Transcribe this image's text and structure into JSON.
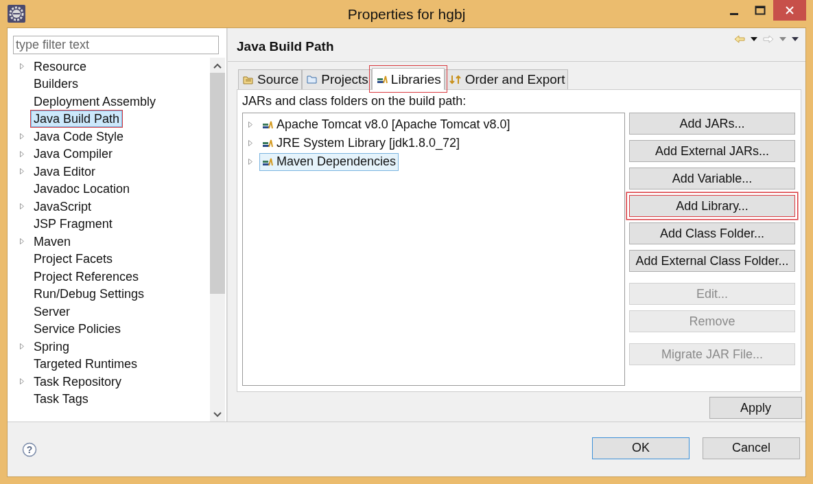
{
  "window": {
    "title": "Properties for hgbj"
  },
  "filter": {
    "placeholder": "type filter text"
  },
  "tree": [
    {
      "label": "Resource",
      "expandable": true,
      "selected": false,
      "annotated": false
    },
    {
      "label": "Builders",
      "expandable": false,
      "selected": false,
      "annotated": false
    },
    {
      "label": "Deployment Assembly",
      "expandable": false,
      "selected": false,
      "annotated": false
    },
    {
      "label": "Java Build Path",
      "expandable": false,
      "selected": true,
      "annotated": true
    },
    {
      "label": "Java Code Style",
      "expandable": true,
      "selected": false,
      "annotated": false
    },
    {
      "label": "Java Compiler",
      "expandable": true,
      "selected": false,
      "annotated": false
    },
    {
      "label": "Java Editor",
      "expandable": true,
      "selected": false,
      "annotated": false
    },
    {
      "label": "Javadoc Location",
      "expandable": false,
      "selected": false,
      "annotated": false
    },
    {
      "label": "JavaScript",
      "expandable": true,
      "selected": false,
      "annotated": false
    },
    {
      "label": "JSP Fragment",
      "expandable": false,
      "selected": false,
      "annotated": false
    },
    {
      "label": "Maven",
      "expandable": true,
      "selected": false,
      "annotated": false
    },
    {
      "label": "Project Facets",
      "expandable": false,
      "selected": false,
      "annotated": false
    },
    {
      "label": "Project References",
      "expandable": false,
      "selected": false,
      "annotated": false
    },
    {
      "label": "Run/Debug Settings",
      "expandable": false,
      "selected": false,
      "annotated": false
    },
    {
      "label": "Server",
      "expandable": false,
      "selected": false,
      "annotated": false
    },
    {
      "label": "Service Policies",
      "expandable": false,
      "selected": false,
      "annotated": false
    },
    {
      "label": "Spring",
      "expandable": true,
      "selected": false,
      "annotated": false
    },
    {
      "label": "Targeted Runtimes",
      "expandable": false,
      "selected": false,
      "annotated": false
    },
    {
      "label": "Task Repository",
      "expandable": true,
      "selected": false,
      "annotated": false
    },
    {
      "label": "Task Tags",
      "expandable": false,
      "selected": false,
      "annotated": false
    }
  ],
  "page": {
    "title": "Java Build Path"
  },
  "tabs": [
    {
      "label": "Source",
      "kind": "source",
      "selected": false,
      "annotated": false
    },
    {
      "label": "Projects",
      "kind": "projects",
      "selected": false,
      "annotated": false
    },
    {
      "label": "Libraries",
      "kind": "libraries",
      "selected": true,
      "annotated": true
    },
    {
      "label": "Order and Export",
      "kind": "order",
      "selected": false,
      "annotated": false
    }
  ],
  "libraries": {
    "caption": "JARs and class folders on the build path:",
    "entries": [
      {
        "label": "Apache Tomcat v8.0 [Apache Tomcat v8.0]",
        "selected": false
      },
      {
        "label": "JRE System Library [jdk1.8.0_72]",
        "selected": false
      },
      {
        "label": "Maven Dependencies",
        "selected": true
      }
    ]
  },
  "button_groups": [
    [
      {
        "label": "Add JARs...",
        "disabled": false,
        "annotated": false
      },
      {
        "label": "Add External JARs...",
        "disabled": false,
        "annotated": false
      },
      {
        "label": "Add Variable...",
        "disabled": false,
        "annotated": false
      },
      {
        "label": "Add Library...",
        "disabled": false,
        "annotated": true
      },
      {
        "label": "Add Class Folder...",
        "disabled": false,
        "annotated": false
      },
      {
        "label": "Add External Class Folder...",
        "disabled": false,
        "annotated": false
      }
    ],
    [
      {
        "label": "Edit...",
        "disabled": true,
        "annotated": false
      },
      {
        "label": "Remove",
        "disabled": true,
        "annotated": false
      }
    ],
    [
      {
        "label": "Migrate JAR File...",
        "disabled": true,
        "annotated": false
      }
    ]
  ],
  "apply": "Apply",
  "help": "?",
  "dialog_buttons": [
    {
      "label": "OK",
      "default": true
    },
    {
      "label": "Cancel",
      "default": false
    }
  ]
}
